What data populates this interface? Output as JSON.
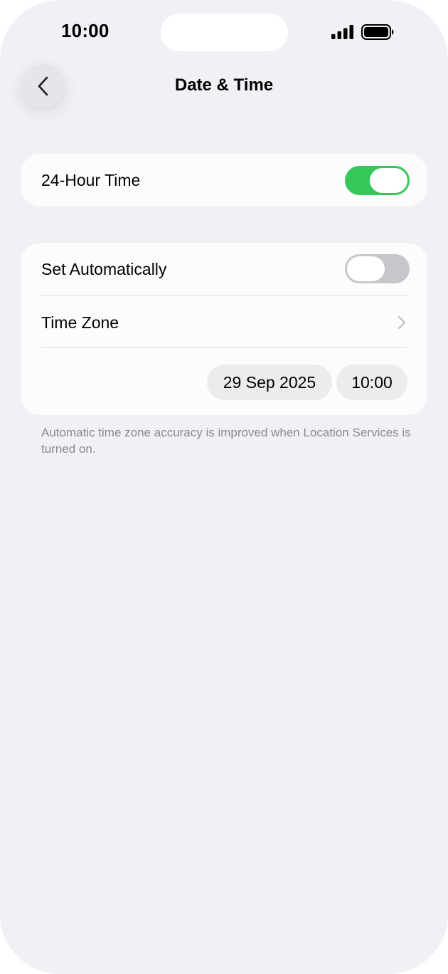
{
  "status_bar": {
    "time": "10:00",
    "signal_icon": "signal-bars-icon",
    "battery_icon": "battery-full-icon"
  },
  "nav": {
    "title": "Date & Time",
    "back_icon": "chevron-left-icon"
  },
  "group_1": {
    "rows": [
      {
        "label": "24-Hour Time",
        "toggle_on": true
      }
    ]
  },
  "group_2": {
    "set_automatically": {
      "label": "Set Automatically",
      "toggle_on": false
    },
    "time_zone": {
      "label": "Time Zone",
      "icon": "chevron-right-icon"
    },
    "date_value": "29 Sep 2025",
    "time_value": "10:00"
  },
  "footnote": "Automatic time zone accuracy is improved when Location Services is turned on.",
  "colors": {
    "background": "#f0f0f5",
    "card": "#fcfcfd",
    "toggle_on": "#34c759",
    "toggle_off": "#c7c7cb",
    "secondary_text": "#8a8a8e"
  }
}
